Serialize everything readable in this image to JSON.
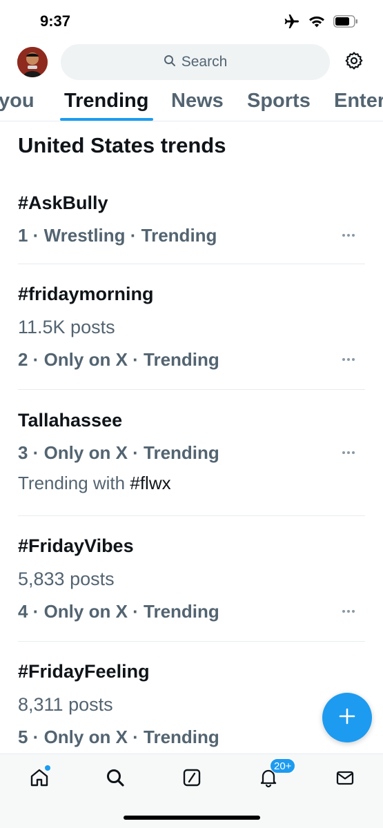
{
  "status_bar": {
    "time": "9:37"
  },
  "header": {
    "search_placeholder": "Search"
  },
  "tabs": [
    {
      "label": "you"
    },
    {
      "label": "Trending"
    },
    {
      "label": "News"
    },
    {
      "label": "Sports"
    },
    {
      "label": "Enter"
    }
  ],
  "active_tab": "Trending",
  "section_title": "United States trends",
  "trends": [
    {
      "name": "#AskBully",
      "meta": "1 · Wrestling · Trending"
    },
    {
      "name": "#fridaymorning",
      "posts": "11.5K posts",
      "meta": "2 · Only on X · Trending"
    },
    {
      "name": "Tallahassee",
      "meta": "3 · Only on X · Trending",
      "with_prefix": "Trending with",
      "with_tag": "#flwx"
    },
    {
      "name": "#FridayVibes",
      "posts": "5,833 posts",
      "meta": "4 · Only on X · Trending"
    },
    {
      "name": "#FridayFeeling",
      "posts": "8,311 posts",
      "meta": "5 · Only on X · Trending"
    }
  ],
  "bottom_nav": {
    "notifications_badge": "20+"
  },
  "colors": {
    "accent": "#1d9bf0",
    "text_primary": "#0f1419",
    "text_secondary": "#536471",
    "divider": "#e6ecf0"
  },
  "icons": {
    "status": [
      "airplane-icon",
      "wifi-icon",
      "battery-icon"
    ],
    "header": [
      "search-icon",
      "gear-icon"
    ],
    "nav": [
      "home-icon",
      "search-icon",
      "grok-icon",
      "bell-icon",
      "mail-icon"
    ],
    "fab": "plus-icon"
  }
}
